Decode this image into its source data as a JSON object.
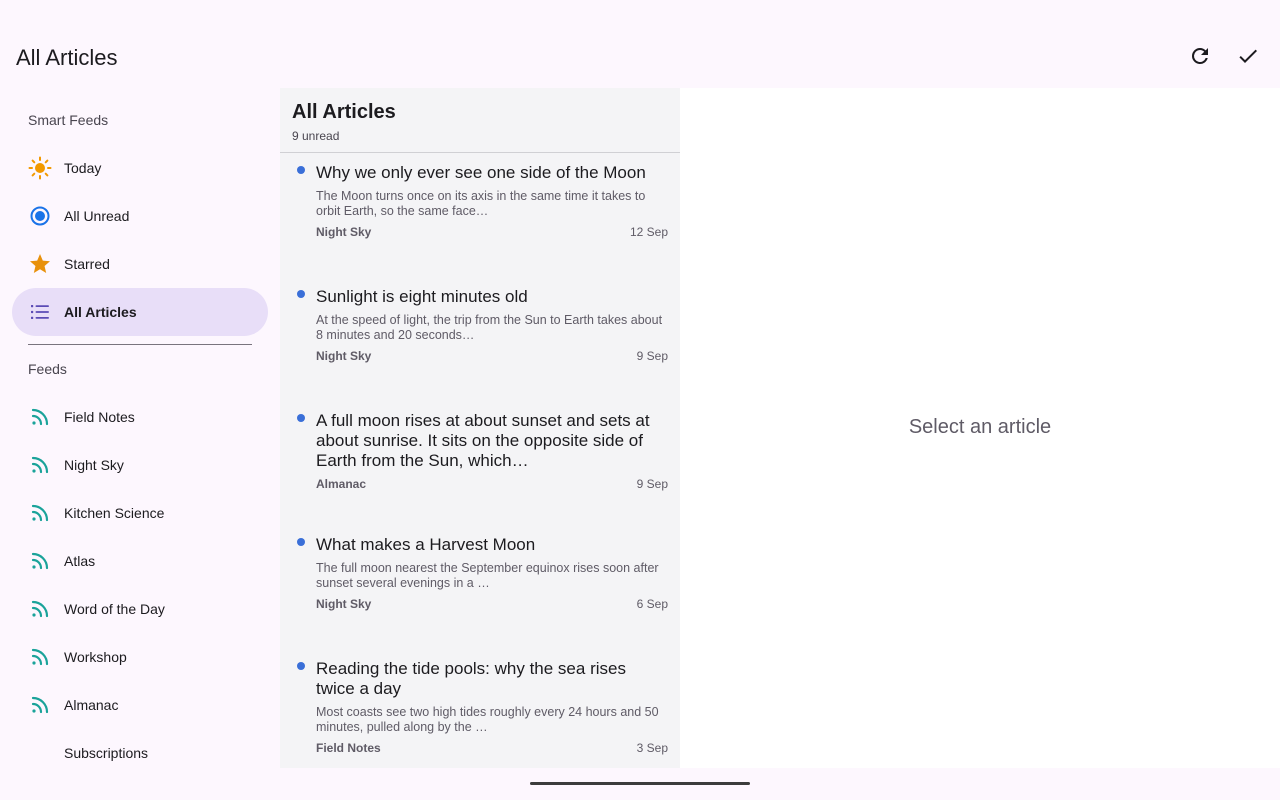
{
  "appbar": {
    "title": "All Articles",
    "actions": [
      {
        "icon": "refresh-icon"
      },
      {
        "icon": "check-icon"
      }
    ]
  },
  "drawer": {
    "smart_header": "Smart Feeds",
    "smart_items": [
      {
        "label": "Today",
        "icon": "sun-icon",
        "color": "#f29900"
      },
      {
        "label": "All Unread",
        "icon": "radio-dot-icon",
        "color": "#1a73e8"
      },
      {
        "label": "Starred",
        "icon": "star-icon",
        "color": "#e8910c"
      },
      {
        "label": "All Articles",
        "icon": "list-icon",
        "color": "#5b4bb5",
        "active": true
      }
    ],
    "feeds_header": "Feeds",
    "feeds": [
      {
        "label": "Field Notes"
      },
      {
        "label": "Night Sky"
      },
      {
        "label": "Kitchen Science"
      },
      {
        "label": "Atlas"
      },
      {
        "label": "Word of the Day"
      },
      {
        "label": "Workshop"
      },
      {
        "label": "Almanac"
      }
    ],
    "subscriptions_label": "Subscriptions",
    "feed_icon_color": "#1aa39a"
  },
  "list": {
    "title": "All Articles",
    "subtitle": "9 unread",
    "articles": [
      {
        "title": "Why we only ever see one side of the Moon",
        "excerpt": "The Moon turns once on its axis in the same time it takes to orbit Earth, so the same face…",
        "source": "Night Sky",
        "date": "12 Sep"
      },
      {
        "title": "Sunlight is eight minutes old",
        "excerpt": "At the speed of light, the trip from the Sun to Earth takes about 8 minutes and 20 seconds…",
        "source": "Night Sky",
        "date": "9 Sep"
      },
      {
        "title": "A full moon rises at about sunset and sets at about sunrise. It sits on the opposite side of Earth from the Sun, which…",
        "excerpt": "",
        "source": "Almanac",
        "date": "9 Sep"
      },
      {
        "title": "What makes a Harvest Moon",
        "excerpt": "The full moon nearest the September equinox rises soon after sunset several evenings in a …",
        "source": "Night Sky",
        "date": "6 Sep"
      },
      {
        "title": "Reading the tide pools: why the sea rises twice a day",
        "excerpt": "Most coasts see two high tides roughly every 24 hours and 50 minutes, pulled along by the …",
        "source": "Field Notes",
        "date": "3 Sep"
      }
    ]
  },
  "detail": {
    "empty_text": "Select an article"
  }
}
